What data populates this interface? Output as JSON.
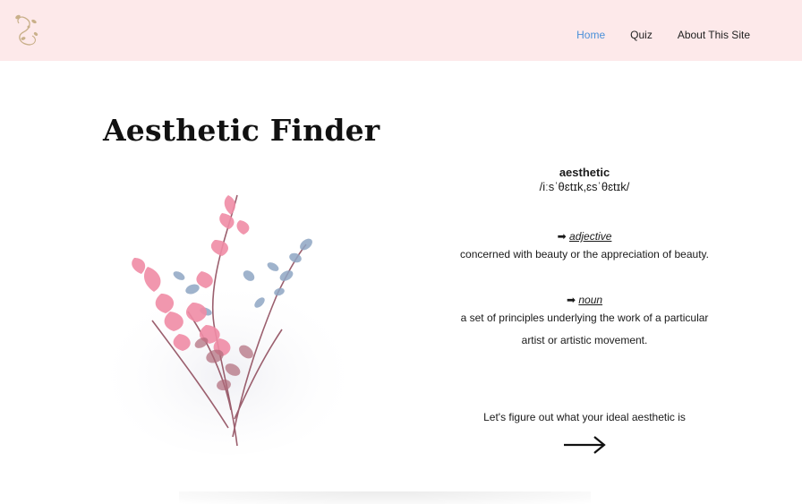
{
  "nav": {
    "items": [
      {
        "label": "Home",
        "active": true
      },
      {
        "label": "Quiz",
        "active": false
      },
      {
        "label": "About This Site",
        "active": false
      }
    ]
  },
  "page": {
    "title": "Aesthetic Finder"
  },
  "definition": {
    "word": "aesthetic",
    "phonetic": "/iːsˈθɛtɪk,ɛsˈθɛtɪk/",
    "adjective": {
      "pointer": "➡",
      "label": "adjective",
      "meaning": "concerned with beauty or the appreciation of beauty."
    },
    "noun": {
      "pointer": "➡",
      "label": "noun",
      "meaning": "a set of principles underlying the work of a particular artist or artistic movement."
    }
  },
  "cta": {
    "text": "Let's figure out what your ideal aesthetic is"
  },
  "colors": {
    "header_bg": "#fde9ea",
    "active_link": "#4a90d9",
    "pink_leaf": "#f08ca6",
    "blue_leaf": "#8fa6c4",
    "stem": "#9b5f6e"
  },
  "icons": {
    "logo": "floral-logo-icon",
    "arrow": "right-arrow-icon"
  }
}
